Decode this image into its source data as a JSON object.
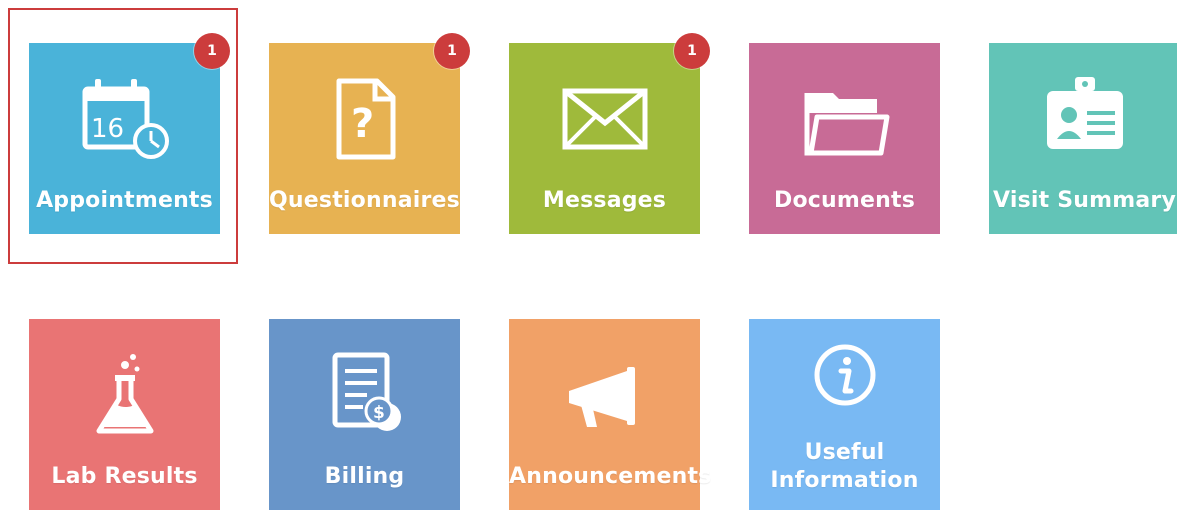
{
  "tiles": [
    {
      "label": "Appointments",
      "color": "#4ab3d9",
      "badge": "1",
      "icon": "calendar-clock-icon",
      "calendar_day": "16"
    },
    {
      "label": "Questionnaires",
      "color": "#e7b252",
      "badge": "1",
      "icon": "document-question-icon"
    },
    {
      "label": "Messages",
      "color": "#9fba3b",
      "badge": "1",
      "icon": "envelope-icon"
    },
    {
      "label": "Documents",
      "color": "#c86b96",
      "icon": "folder-icon"
    },
    {
      "label": "Visit Summary",
      "color": "#62c4b7",
      "icon": "id-badge-icon"
    },
    {
      "label": "Lab Results",
      "color": "#e97474",
      "icon": "flask-icon"
    },
    {
      "label": "Billing",
      "color": "#6895c9",
      "icon": "invoice-coins-icon"
    },
    {
      "label": "Announcements",
      "color": "#f1a167",
      "icon": "megaphone-icon"
    },
    {
      "label_line1": "Useful",
      "label_line2": "Information",
      "color": "#79b9f3",
      "icon": "info-icon"
    }
  ],
  "selected_tile": "Appointments"
}
